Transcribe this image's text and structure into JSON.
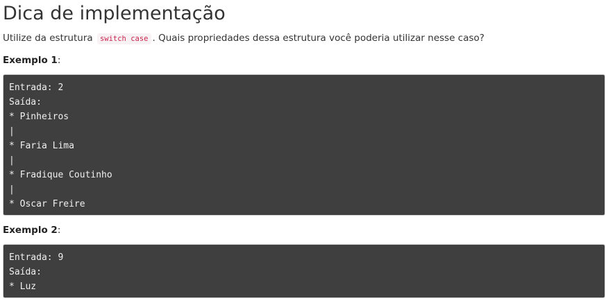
{
  "page": {
    "title": "Dica de implementação",
    "hint": {
      "before": "Utilize da estrutura ",
      "code": "switch case",
      "after": ". Quais propriedades dessa estrutura você poderia utilizar nesse caso?"
    }
  },
  "examples": [
    {
      "label": "Exemplo 1",
      "label_suffix": ":",
      "lines": [
        "Entrada: 2",
        "Saída:",
        "* Pinheiros",
        "|",
        "* Faria Lima",
        "|",
        "* Fradique Coutinho",
        "|",
        "* Oscar Freire"
      ]
    },
    {
      "label": "Exemplo 2",
      "label_suffix": ":",
      "lines": [
        "Entrada: 9",
        "Saída:",
        "* Luz"
      ]
    }
  ],
  "colors": {
    "code_block_bg": "#3f3f3f",
    "code_text": "#f0f0f0",
    "inline_code_text": "#c7254e",
    "inline_code_bg": "#f9f2f4"
  }
}
